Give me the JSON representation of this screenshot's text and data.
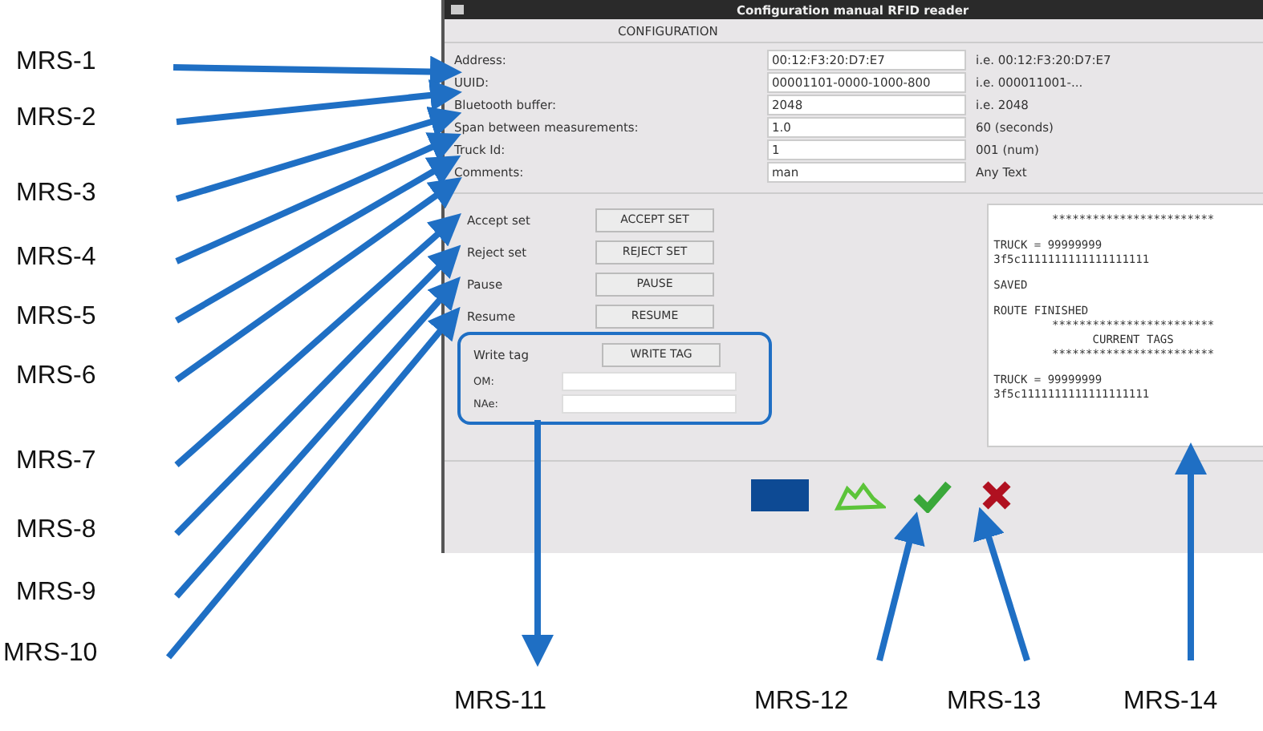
{
  "callouts": [
    {
      "label": "MRS-1"
    },
    {
      "label": "MRS-2"
    },
    {
      "label": "MRS-3"
    },
    {
      "label": "MRS-4"
    },
    {
      "label": "MRS-5"
    },
    {
      "label": "MRS-6"
    },
    {
      "label": "MRS-7"
    },
    {
      "label": "MRS-8"
    },
    {
      "label": "MRS-9"
    },
    {
      "label": "MRS-10"
    },
    {
      "label": "MRS-11"
    },
    {
      "label": "MRS-12"
    },
    {
      "label": "MRS-13"
    },
    {
      "label": "MRS-14"
    }
  ],
  "window": {
    "title": "Configuration manual RFID reader",
    "section_title": "CONFIGURATION",
    "fields": [
      {
        "label": "Address:",
        "value": "00:12:F3:20:D7:E7",
        "hint": "i.e. 00:12:F3:20:D7:E7"
      },
      {
        "label": "UUID:",
        "value": "00001101-0000-1000-800",
        "hint": "i.e. 000011001-..."
      },
      {
        "label": "Bluetooth buffer:",
        "value": "2048",
        "hint": "i.e. 2048"
      },
      {
        "label": "Span between measurements:",
        "value": "1.0",
        "hint": "60 (seconds)"
      },
      {
        "label": "Truck Id:",
        "value": "1",
        "hint": "001 (num)"
      },
      {
        "label": "Comments:",
        "value": "man",
        "hint": "Any Text"
      }
    ],
    "actions": [
      {
        "label": "Accept set",
        "button": "ACCEPT SET"
      },
      {
        "label": "Reject set",
        "button": "REJECT SET"
      },
      {
        "label": "Pause",
        "button": "PAUSE"
      },
      {
        "label": "Resume",
        "button": "RESUME"
      }
    ],
    "write_tag": {
      "label": "Write tag",
      "button": "WRITE TAG",
      "fields": [
        {
          "label": "OM:"
        },
        {
          "label": "NAe:"
        }
      ]
    },
    "log": [
      {
        "lines": [
          {
            "kind": "separator",
            "text": "************************"
          }
        ]
      },
      {
        "lines": [
          {
            "kind": "text",
            "text": "TRUCK = 99999999"
          },
          {
            "kind": "text",
            "text": "3f5c1111111111111111111"
          }
        ]
      },
      {
        "lines": [
          {
            "kind": "text",
            "text": "SAVED"
          }
        ]
      },
      {
        "lines": [
          {
            "kind": "text",
            "text": "ROUTE FINISHED"
          },
          {
            "kind": "separator",
            "text": "************************"
          },
          {
            "kind": "heading",
            "text": "CURRENT TAGS"
          },
          {
            "kind": "separator",
            "text": "************************"
          }
        ]
      },
      {
        "lines": [
          {
            "kind": "text",
            "text": "TRUCK = 99999999"
          },
          {
            "kind": "text",
            "text": "3f5c1111111111111111111"
          }
        ]
      }
    ],
    "toolbar": [
      {
        "kind": "panel"
      },
      {
        "kind": "chart"
      },
      {
        "kind": "accept"
      },
      {
        "kind": "cancel"
      }
    ]
  }
}
